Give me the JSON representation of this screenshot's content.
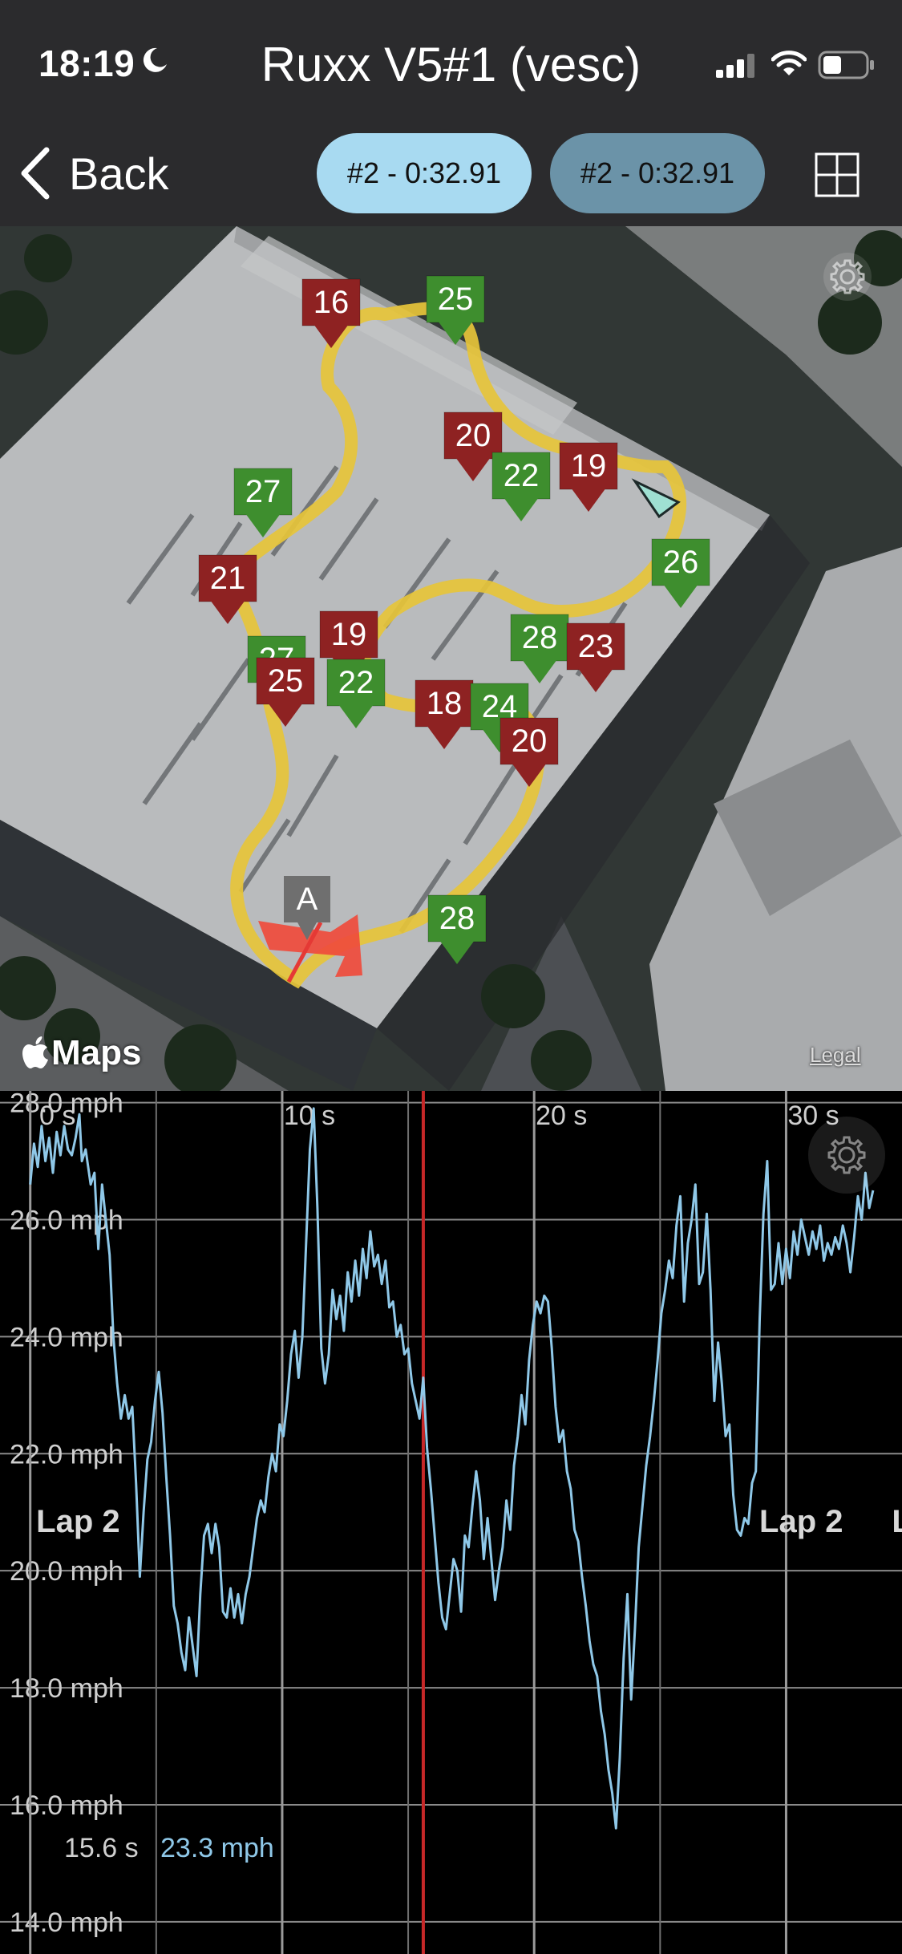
{
  "status_bar": {
    "time": "18:19",
    "icons": [
      "moon-icon",
      "signal-icon",
      "wifi-icon",
      "battery-icon"
    ]
  },
  "app_title": "Ruxx V5#1 (vesc)",
  "nav": {
    "back_label": "Back",
    "lap_pill_1": "#2 - 0:32.91",
    "lap_pill_2": "#2 - 0:32.91",
    "grid_icon": "grid-view-icon"
  },
  "map": {
    "attribution": "Maps",
    "legal": "Legal",
    "start_marker": "A",
    "colors": {
      "track": "#e6c43a",
      "fast_marker": "#3e8e2e",
      "slow_marker": "#8e2222",
      "start_marker": "#6f6f6f",
      "direction_arrow": "#ef4b3c",
      "cursor": "#9fe0d2"
    },
    "speed_markers": [
      {
        "label": "16",
        "kind": "slow"
      },
      {
        "label": "25",
        "kind": "fast"
      },
      {
        "label": "20",
        "kind": "slow"
      },
      {
        "label": "22",
        "kind": "fast"
      },
      {
        "label": "19",
        "kind": "slow"
      },
      {
        "label": "27",
        "kind": "fast"
      },
      {
        "label": "26",
        "kind": "fast"
      },
      {
        "label": "21",
        "kind": "slow"
      },
      {
        "label": "27",
        "kind": "fast"
      },
      {
        "label": "19",
        "kind": "slow"
      },
      {
        "label": "28",
        "kind": "fast"
      },
      {
        "label": "23",
        "kind": "slow"
      },
      {
        "label": "25",
        "kind": "slow"
      },
      {
        "label": "22",
        "kind": "fast"
      },
      {
        "label": "18",
        "kind": "slow"
      },
      {
        "label": "24",
        "kind": "fast"
      },
      {
        "label": "20",
        "kind": "slow"
      },
      {
        "label": "28",
        "kind": "fast"
      }
    ]
  },
  "chart_data": {
    "type": "line",
    "xlabel": "",
    "ylabel": "",
    "x_ticks": [
      "0 s",
      "10 s",
      "20 s",
      "30 s"
    ],
    "y_ticks": [
      "28.0 mph",
      "26.0 mph",
      "24.0 mph",
      "22.0 mph",
      "20.0 mph",
      "18.0 mph",
      "16.0 mph",
      "14.0 mph"
    ],
    "y_tick_values": [
      28,
      26,
      24,
      22,
      20,
      18,
      16,
      14
    ],
    "x_tick_values": [
      0,
      10,
      20,
      30
    ],
    "xlim": [
      -1.2,
      34.6
    ],
    "ylim": [
      13.45,
      28.2
    ],
    "grid": true,
    "line_color": "#8fc8e8",
    "cursor": {
      "x": 15.6,
      "color": "#c62828"
    },
    "cursor_readout": {
      "time": "15.6 s",
      "speed": "23.3 mph"
    },
    "lap_labels": [
      {
        "text": "Lap 2",
        "x": 1.9
      },
      {
        "text": "Lap 2",
        "x": 30.6
      },
      {
        "text": "L",
        "x": 34.2
      }
    ],
    "series": [
      {
        "values": [
          [
            0.0,
            26.6
          ],
          [
            0.15,
            27.3
          ],
          [
            0.3,
            26.9
          ],
          [
            0.45,
            27.6
          ],
          [
            0.6,
            27.0
          ],
          [
            0.75,
            27.4
          ],
          [
            0.9,
            26.8
          ],
          [
            1.05,
            27.5
          ],
          [
            1.2,
            27.1
          ],
          [
            1.35,
            27.6
          ],
          [
            1.5,
            27.2
          ],
          [
            1.65,
            27.1
          ],
          [
            1.8,
            27.4
          ],
          [
            1.95,
            27.8
          ],
          [
            2.05,
            27.0
          ],
          [
            2.2,
            27.2
          ],
          [
            2.4,
            26.6
          ],
          [
            2.55,
            26.8
          ],
          [
            2.7,
            25.5
          ],
          [
            2.85,
            26.6
          ],
          [
            3.0,
            26.0
          ],
          [
            3.15,
            25.4
          ],
          [
            3.3,
            24.0
          ],
          [
            3.45,
            23.2
          ],
          [
            3.6,
            22.6
          ],
          [
            3.75,
            23.0
          ],
          [
            3.9,
            22.6
          ],
          [
            4.05,
            22.8
          ],
          [
            4.2,
            21.5
          ],
          [
            4.35,
            19.9
          ],
          [
            4.5,
            21.0
          ],
          [
            4.65,
            21.9
          ],
          [
            4.8,
            22.2
          ],
          [
            4.95,
            22.9
          ],
          [
            5.1,
            23.4
          ],
          [
            5.25,
            22.7
          ],
          [
            5.4,
            21.6
          ],
          [
            5.55,
            20.6
          ],
          [
            5.7,
            19.4
          ],
          [
            5.85,
            19.1
          ],
          [
            6.0,
            18.6
          ],
          [
            6.15,
            18.3
          ],
          [
            6.3,
            19.2
          ],
          [
            6.45,
            18.7
          ],
          [
            6.6,
            18.2
          ],
          [
            6.75,
            19.6
          ],
          [
            6.9,
            20.6
          ],
          [
            7.05,
            20.8
          ],
          [
            7.2,
            20.3
          ],
          [
            7.35,
            20.8
          ],
          [
            7.5,
            20.4
          ],
          [
            7.65,
            19.3
          ],
          [
            7.8,
            19.2
          ],
          [
            7.95,
            19.7
          ],
          [
            8.1,
            19.2
          ],
          [
            8.25,
            19.6
          ],
          [
            8.4,
            19.1
          ],
          [
            8.55,
            19.6
          ],
          [
            8.7,
            19.9
          ],
          [
            8.85,
            20.4
          ],
          [
            9.0,
            20.9
          ],
          [
            9.15,
            21.2
          ],
          [
            9.3,
            21.0
          ],
          [
            9.45,
            21.6
          ],
          [
            9.6,
            22.0
          ],
          [
            9.75,
            21.7
          ],
          [
            9.9,
            22.5
          ],
          [
            10.05,
            22.3
          ],
          [
            10.2,
            22.9
          ],
          [
            10.35,
            23.7
          ],
          [
            10.5,
            24.1
          ],
          [
            10.65,
            23.3
          ],
          [
            10.8,
            24.0
          ],
          [
            10.95,
            25.6
          ],
          [
            11.1,
            27.2
          ],
          [
            11.25,
            27.9
          ],
          [
            11.4,
            26.2
          ],
          [
            11.55,
            23.8
          ],
          [
            11.7,
            23.2
          ],
          [
            11.85,
            23.7
          ],
          [
            12.0,
            24.8
          ],
          [
            12.15,
            24.3
          ],
          [
            12.3,
            24.7
          ],
          [
            12.45,
            24.1
          ],
          [
            12.6,
            25.1
          ],
          [
            12.75,
            24.6
          ],
          [
            12.9,
            25.3
          ],
          [
            13.05,
            24.7
          ],
          [
            13.2,
            25.5
          ],
          [
            13.35,
            25.0
          ],
          [
            13.5,
            25.8
          ],
          [
            13.65,
            25.2
          ],
          [
            13.8,
            25.4
          ],
          [
            13.95,
            24.9
          ],
          [
            14.1,
            25.3
          ],
          [
            14.25,
            24.5
          ],
          [
            14.4,
            24.6
          ],
          [
            14.55,
            24.0
          ],
          [
            14.7,
            24.2
          ],
          [
            14.85,
            23.7
          ],
          [
            15.0,
            23.8
          ],
          [
            15.15,
            23.2
          ],
          [
            15.3,
            22.9
          ],
          [
            15.45,
            22.6
          ],
          [
            15.6,
            23.3
          ],
          [
            15.75,
            22.1
          ],
          [
            15.9,
            21.4
          ],
          [
            16.05,
            20.6
          ],
          [
            16.2,
            19.8
          ],
          [
            16.35,
            19.2
          ],
          [
            16.5,
            19.0
          ],
          [
            16.65,
            19.6
          ],
          [
            16.8,
            20.2
          ],
          [
            16.95,
            20.0
          ],
          [
            17.1,
            19.3
          ],
          [
            17.25,
            20.6
          ],
          [
            17.4,
            20.4
          ],
          [
            17.55,
            21.1
          ],
          [
            17.7,
            21.7
          ],
          [
            17.85,
            21.2
          ],
          [
            18.0,
            20.2
          ],
          [
            18.15,
            20.9
          ],
          [
            18.3,
            20.2
          ],
          [
            18.45,
            19.5
          ],
          [
            18.6,
            20.0
          ],
          [
            18.75,
            20.4
          ],
          [
            18.9,
            21.2
          ],
          [
            19.05,
            20.7
          ],
          [
            19.2,
            21.8
          ],
          [
            19.35,
            22.3
          ],
          [
            19.5,
            23.0
          ],
          [
            19.65,
            22.5
          ],
          [
            19.8,
            23.6
          ],
          [
            19.95,
            24.2
          ],
          [
            20.1,
            24.6
          ],
          [
            20.25,
            24.4
          ],
          [
            20.4,
            24.7
          ],
          [
            20.55,
            24.6
          ],
          [
            20.7,
            23.8
          ],
          [
            20.85,
            22.8
          ],
          [
            21.0,
            22.2
          ],
          [
            21.15,
            22.4
          ],
          [
            21.3,
            21.7
          ],
          [
            21.45,
            21.4
          ],
          [
            21.6,
            20.7
          ],
          [
            21.75,
            20.5
          ],
          [
            21.9,
            19.9
          ],
          [
            22.05,
            19.4
          ],
          [
            22.2,
            18.8
          ],
          [
            22.35,
            18.4
          ],
          [
            22.5,
            18.2
          ],
          [
            22.65,
            17.6
          ],
          [
            22.8,
            17.2
          ],
          [
            22.95,
            16.6
          ],
          [
            23.1,
            16.2
          ],
          [
            23.25,
            15.6
          ],
          [
            23.4,
            16.8
          ],
          [
            23.55,
            18.5
          ],
          [
            23.7,
            19.6
          ],
          [
            23.85,
            17.8
          ],
          [
            24.0,
            19.0
          ],
          [
            24.15,
            20.4
          ],
          [
            24.3,
            21.1
          ],
          [
            24.45,
            21.8
          ],
          [
            24.6,
            22.3
          ],
          [
            24.75,
            22.9
          ],
          [
            24.9,
            23.6
          ],
          [
            25.05,
            24.4
          ],
          [
            25.2,
            24.8
          ],
          [
            25.35,
            25.3
          ],
          [
            25.5,
            25.0
          ],
          [
            25.65,
            25.9
          ],
          [
            25.8,
            26.4
          ],
          [
            25.95,
            24.6
          ],
          [
            26.1,
            25.6
          ],
          [
            26.25,
            26.0
          ],
          [
            26.4,
            26.6
          ],
          [
            26.55,
            24.9
          ],
          [
            26.7,
            25.1
          ],
          [
            26.85,
            26.1
          ],
          [
            27.0,
            24.8
          ],
          [
            27.15,
            22.9
          ],
          [
            27.3,
            23.9
          ],
          [
            27.45,
            23.2
          ],
          [
            27.6,
            22.3
          ],
          [
            27.75,
            22.5
          ],
          [
            27.9,
            21.3
          ],
          [
            28.05,
            20.7
          ],
          [
            28.2,
            20.6
          ],
          [
            28.35,
            20.9
          ],
          [
            28.5,
            20.8
          ],
          [
            28.65,
            21.5
          ],
          [
            28.8,
            21.7
          ],
          [
            28.95,
            24.3
          ],
          [
            29.1,
            26.1
          ],
          [
            29.25,
            27.0
          ],
          [
            29.4,
            24.8
          ],
          [
            29.55,
            24.9
          ],
          [
            29.7,
            25.6
          ],
          [
            29.85,
            24.9
          ],
          [
            30.0,
            25.5
          ],
          [
            30.15,
            25.0
          ],
          [
            30.3,
            25.8
          ],
          [
            30.45,
            25.4
          ],
          [
            30.6,
            26.0
          ],
          [
            30.75,
            25.7
          ],
          [
            30.9,
            25.4
          ],
          [
            31.05,
            25.8
          ],
          [
            31.2,
            25.5
          ],
          [
            31.35,
            25.9
          ],
          [
            31.5,
            25.3
          ],
          [
            31.65,
            25.6
          ],
          [
            31.8,
            25.4
          ],
          [
            31.95,
            25.7
          ],
          [
            32.1,
            25.5
          ],
          [
            32.25,
            25.9
          ],
          [
            32.4,
            25.6
          ],
          [
            32.55,
            25.1
          ],
          [
            32.7,
            25.7
          ],
          [
            32.85,
            26.4
          ],
          [
            33.0,
            26.0
          ],
          [
            33.15,
            26.8
          ],
          [
            33.3,
            26.2
          ],
          [
            33.45,
            26.5
          ]
        ]
      }
    ]
  }
}
